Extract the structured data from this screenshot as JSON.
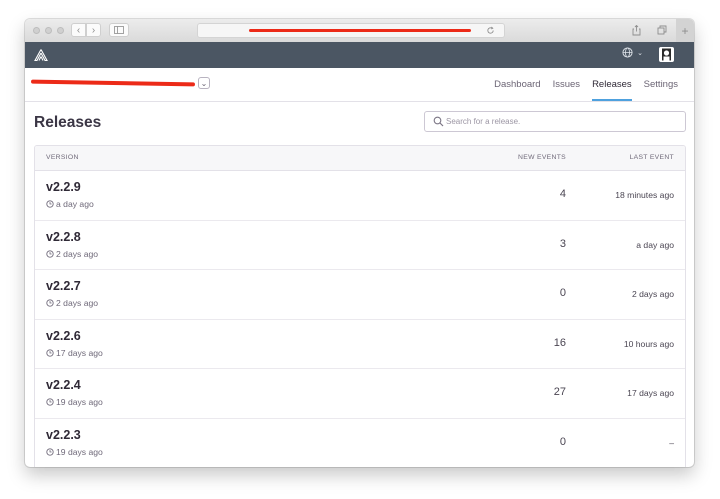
{
  "appbar": {
    "globe_caret": "⌄"
  },
  "tabs": [
    "Dashboard",
    "Issues",
    "Releases",
    "Settings"
  ],
  "active_tab": "Releases",
  "page": {
    "title": "Releases"
  },
  "search": {
    "placeholder": "Search for a release.",
    "value": ""
  },
  "table": {
    "headers": {
      "version": "VERSION",
      "new_events": "NEW EVENTS",
      "last_event": "LAST EVENT"
    },
    "rows": [
      {
        "version": "v2.2.9",
        "created": "a day ago",
        "new_events": "4",
        "last_event": "18 minutes ago"
      },
      {
        "version": "v2.2.8",
        "created": "2 days ago",
        "new_events": "3",
        "last_event": "a day ago"
      },
      {
        "version": "v2.2.7",
        "created": "2 days ago",
        "new_events": "0",
        "last_event": "2 days ago"
      },
      {
        "version": "v2.2.6",
        "created": "17 days ago",
        "new_events": "16",
        "last_event": "10 hours ago"
      },
      {
        "version": "v2.2.4",
        "created": "19 days ago",
        "new_events": "27",
        "last_event": "17 days ago"
      },
      {
        "version": "v2.2.3",
        "created": "19 days ago",
        "new_events": "0",
        "last_event": "–"
      }
    ]
  },
  "colors": {
    "appbar": "#4b5663",
    "accent": "#4ea1de",
    "redaction": "#ec2a18"
  },
  "icons": [
    "back-icon",
    "forward-icon",
    "sidebar-icon",
    "info-icon",
    "reload-icon",
    "share-icon",
    "tabs-icon",
    "new-tab-icon",
    "sentry-logo-icon",
    "globe-icon",
    "avatar",
    "chevron-down-icon",
    "search-icon",
    "clock-icon"
  ]
}
